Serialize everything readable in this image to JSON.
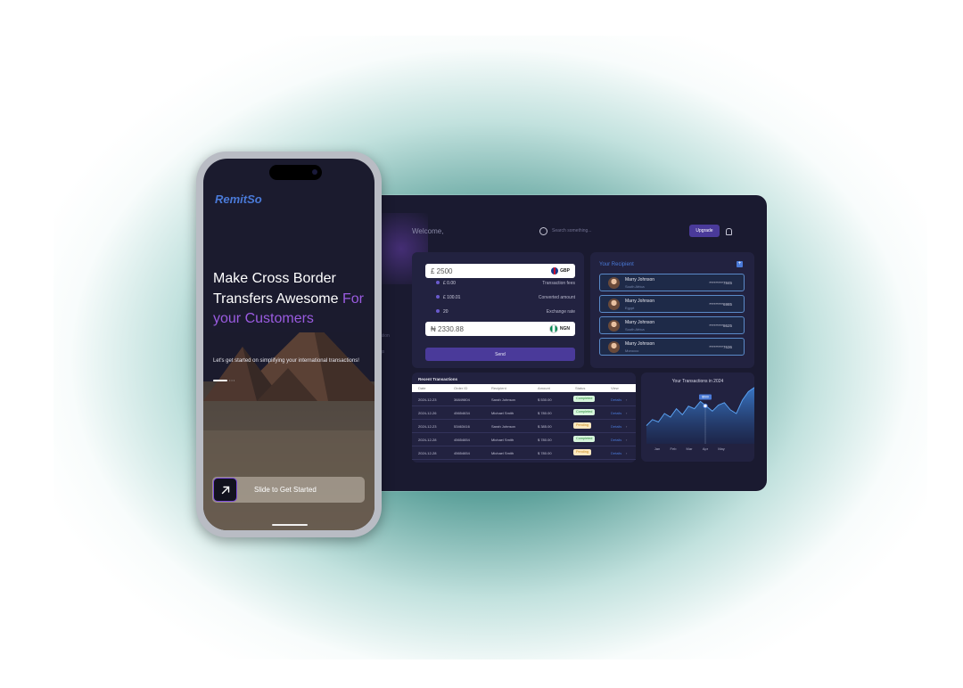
{
  "colors": {
    "brand_blue": "#4a7ad8",
    "accent_purple": "#9a5be0",
    "button_purple": "#4a3a9a",
    "dashboard_bg": "#1a1a30",
    "panel_bg": "#222240",
    "completed_green": "#2a8a3a",
    "pending_amber": "#c88a1a"
  },
  "mobile": {
    "logo": "RemitSo",
    "headline": "Make Cross Border Transfers Awesome",
    "headline_accent": "For your Customers",
    "tagline": "Let's get started on simplifying your international transactions!",
    "slide_label": "Slide to Get Started",
    "slide_icon": "arrow-up-right-icon",
    "onboarding_step": 1,
    "onboarding_total": 3
  },
  "dashboard": {
    "welcome": "Welcome,",
    "search_placeholder": "Search something...",
    "upgrade_label": "Upgrade",
    "sidebar_fragments": [
      "ation",
      "gs"
    ],
    "converter": {
      "send_amount": "£ 2500",
      "send_currency": "GBP",
      "fees": [
        {
          "value": "£ 0.00",
          "label": "Transaction fees"
        },
        {
          "value": "£ 100.01",
          "label": "Converted amount"
        },
        {
          "value": "20",
          "label": "Exchange rate"
        }
      ],
      "receive_amount": "₦ 2330.88",
      "receive_currency": "NGN",
      "send_label": "Send"
    },
    "recipients": {
      "title": "Your Recipient",
      "add_label": "+",
      "items": [
        {
          "name": "Marry Johnson",
          "country": "South Africa",
          "account": "*********7845"
        },
        {
          "name": "Marry Johnson",
          "country": "Egypt",
          "account": "*********6985"
        },
        {
          "name": "Marry Johnson",
          "country": "South Africa",
          "account": "*********8625"
        },
        {
          "name": "Marry Johnson",
          "country": "Morocco",
          "account": "*********7636"
        }
      ]
    },
    "transactions": {
      "title": "Recent Transactions",
      "columns": [
        "Date",
        "Order ID",
        "Recipient",
        "Amount",
        "Status",
        "View"
      ],
      "rows": [
        {
          "date": "2024-12-23",
          "order": "36849804",
          "recipient": "Sarah Johnson",
          "amount": "$ 530.00",
          "status": "Completed",
          "status_type": "completed",
          "view": "Details"
        },
        {
          "date": "2024-12-26",
          "order": "45654634",
          "recipient": "Michael Smith",
          "amount": "$ 780.00",
          "status": "Completed",
          "status_type": "completed",
          "view": "Details"
        },
        {
          "date": "2024-12-23",
          "order": "53463416",
          "recipient": "Sarah Johnson",
          "amount": "$ 385.00",
          "status": "Pending",
          "status_type": "pending",
          "view": "Details"
        },
        {
          "date": "2024-12-28",
          "order": "45654654",
          "recipient": "Michael Smith",
          "amount": "$ 780.00",
          "status": "Completed",
          "status_type": "completed",
          "view": "Details"
        },
        {
          "date": "2024-12-28",
          "order": "45654654",
          "recipient": "Michael Smith",
          "amount": "$ 780.00",
          "status": "Pending",
          "status_type": "pending",
          "view": "Details"
        }
      ]
    },
    "chart_panel": {
      "title": "Your Transactions in 2024"
    }
  },
  "chart_data": {
    "type": "area",
    "title": "Your Transactions in 2024",
    "categories": [
      "Jan",
      "Feb",
      "Mar",
      "Apr",
      "May"
    ],
    "x": [
      0,
      0.25,
      0.5,
      0.75,
      1,
      1.25,
      1.5,
      1.75,
      2,
      2.25,
      2.5,
      2.75,
      3,
      3.25,
      3.5,
      3.75,
      4,
      4.25,
      4.5
    ],
    "values": [
      30,
      40,
      36,
      50,
      44,
      58,
      48,
      62,
      58,
      70,
      62,
      54,
      64,
      68,
      56,
      50,
      72,
      86,
      93
    ],
    "highlight": {
      "x": 3,
      "label": "$500"
    },
    "ylim": [
      0,
      100
    ],
    "grid": false,
    "legend": "none"
  }
}
